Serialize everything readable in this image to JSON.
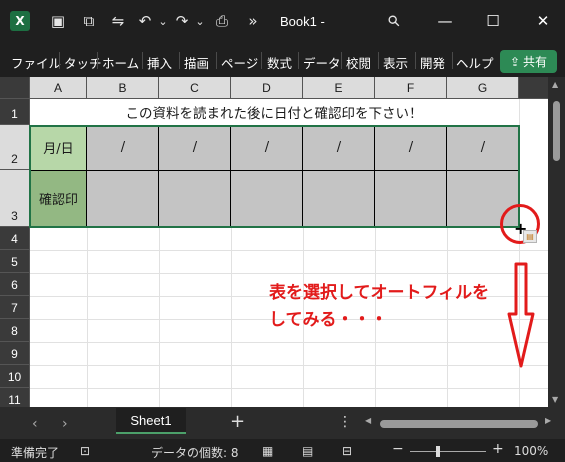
{
  "app": {
    "title": "Book1  -",
    "logo_letter": "X",
    "icons": [
      "save-icon",
      "copy-icon",
      "autosave-icon",
      "undo-icon",
      "redo-icon",
      "print-icon",
      "more-icon",
      "search-icon",
      "minimize-icon",
      "maximize-icon",
      "close-icon"
    ],
    "glyphs": {
      "save": "▣",
      "copy": "⧉",
      "autosave": "⇋",
      "undo": "↶",
      "redo": "↷",
      "dd1": "⌄",
      "dd2": "⌄",
      "print": "⎙",
      "more": "»",
      "search": "⚲",
      "minimize": "—",
      "maximize": "☐",
      "close": "✕"
    }
  },
  "ribbon": {
    "tabs": [
      "ファイル",
      "タッチ",
      "ホーム",
      "挿入",
      "描画",
      "ページ",
      "数式",
      "データ",
      "校閲",
      "表示",
      "開発",
      "ヘルプ"
    ],
    "share_label": "共有",
    "share_icon": "⇪"
  },
  "grid": {
    "columns": [
      "A",
      "B",
      "C",
      "D",
      "E",
      "F",
      "G"
    ],
    "rows": [
      "1",
      "2",
      "3",
      "4",
      "5",
      "6",
      "7",
      "8",
      "9",
      "10",
      "11"
    ],
    "header_text": "この資料を読まれた後に日付と確認印を下さい！",
    "date_label": "月/日",
    "confirm_label": "確認印",
    "slash": "/",
    "selected_cells_count": 8
  },
  "annotation": {
    "line1": "表を選択してオートフィルを",
    "line2": "してみる・・・",
    "color": "#e21b1b"
  },
  "sheets": {
    "nav_prev": "‹",
    "nav_next": "›",
    "active_tab": "Sheet1",
    "add": "+",
    "more": "⋮"
  },
  "status": {
    "ready": "準備完了",
    "count": "データの個数: 8",
    "zoom_minus": "−",
    "zoom_plus": "+",
    "zoom": "100%"
  },
  "colors": {
    "excel_green": "#1d6f42",
    "date_label_bg": "#b7d7a8",
    "confirm_label_bg": "#93b883",
    "table_gray": "#c4c4c4",
    "selection": "#217346"
  }
}
